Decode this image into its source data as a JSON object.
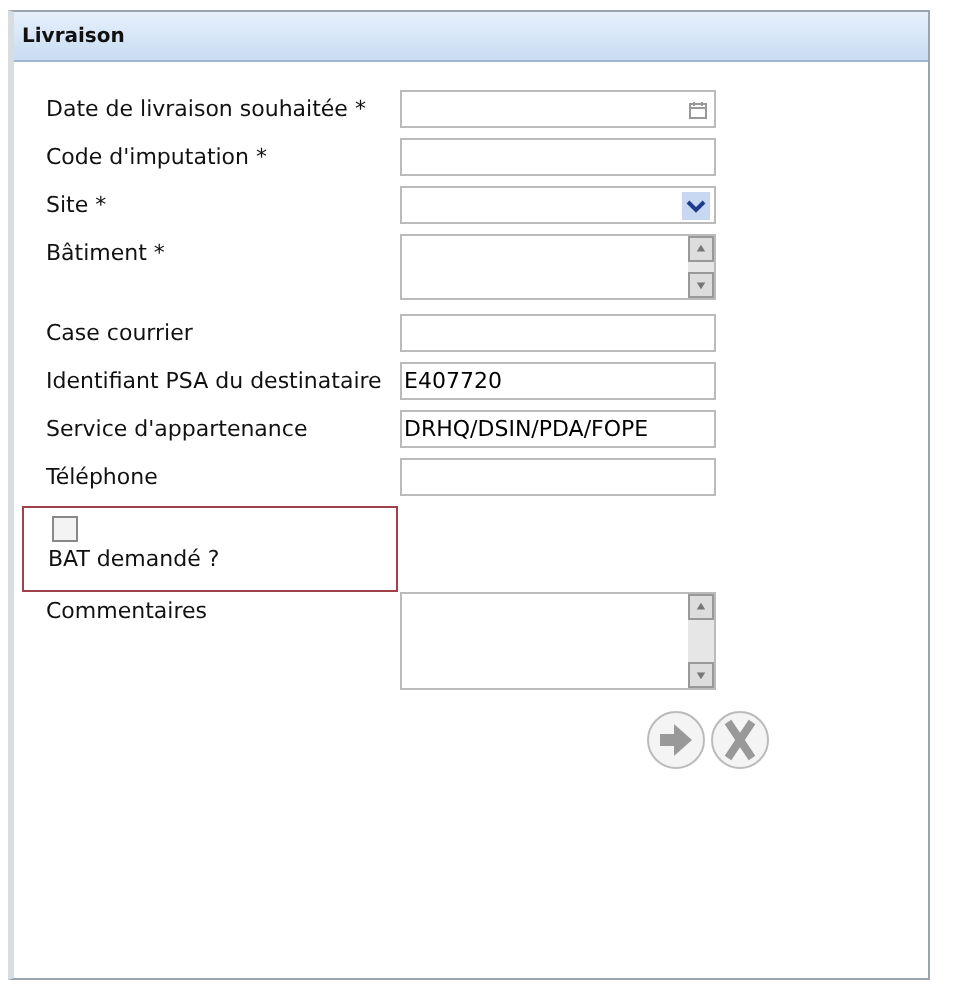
{
  "panel": {
    "title": "Livraison"
  },
  "fields": [
    {
      "kind": "date",
      "label": "Date de livraison souhaitée *"
    },
    {
      "kind": "text",
      "label": "Code d'imputation *"
    },
    {
      "kind": "select",
      "label": "Site *"
    },
    {
      "kind": "textarea",
      "label": "Bâtiment *"
    },
    {
      "kind": "text",
      "label": "Case courrier"
    },
    {
      "kind": "text",
      "label": "Identifiant PSA du destinataire",
      "value": "E407720"
    },
    {
      "kind": "text",
      "label": "Service d'appartenance",
      "value": "DRHQ/DSIN/PDA/FOPE"
    },
    {
      "kind": "text",
      "label": "Téléphone"
    },
    {
      "kind": "checkbox",
      "label": "BAT demandé ?",
      "checked": false
    },
    {
      "kind": "memo",
      "label": "Commentaires"
    }
  ],
  "actions": [
    {
      "kind": "next"
    },
    {
      "kind": "cancel"
    }
  ]
}
